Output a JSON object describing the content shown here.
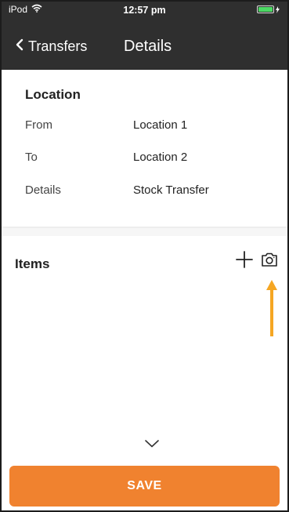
{
  "status_bar": {
    "carrier": "iPod",
    "time": "12:57 pm",
    "wifi_icon": "wifi-icon",
    "battery_icon": "battery-icon",
    "battery_color": "#4cd964"
  },
  "nav": {
    "back_label": "Transfers",
    "title": "Details"
  },
  "location": {
    "section_title": "Location",
    "rows": [
      {
        "label": "From",
        "value": "Location 1"
      },
      {
        "label": "To",
        "value": "Location 2"
      },
      {
        "label": "Details",
        "value": "Stock Transfer"
      }
    ]
  },
  "items": {
    "section_title": "Items",
    "add_icon": "plus-icon",
    "camera_icon": "camera-icon",
    "annotation_arrow_color": "#f5a623"
  },
  "footer": {
    "expand_icon": "chevron-down-icon",
    "save_label": "SAVE",
    "save_color": "#f0822f"
  }
}
